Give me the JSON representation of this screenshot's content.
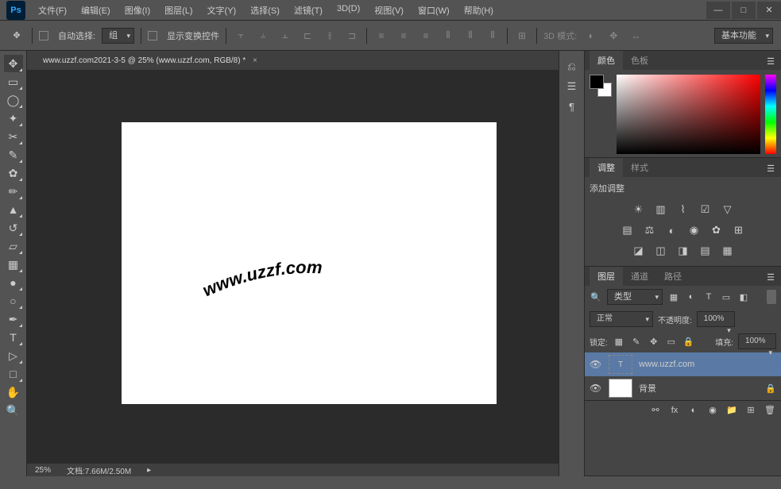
{
  "app": {
    "logo": "Ps"
  },
  "menu": [
    "文件(F)",
    "编辑(E)",
    "图像(I)",
    "图层(L)",
    "文字(Y)",
    "选择(S)",
    "滤镜(T)",
    "3D(D)",
    "视图(V)",
    "窗口(W)",
    "帮助(H)"
  ],
  "optbar": {
    "auto_select": "自动选择:",
    "group": "组",
    "show_transform": "显示变换控件",
    "mode_3d": "3D 模式:",
    "workspace": "基本功能"
  },
  "doc": {
    "tab": "www.uzzf.com2021-3-5 @ 25% (www.uzzf.com, RGB/8) *"
  },
  "canvas": {
    "text": "www.uzzf.com"
  },
  "status": {
    "zoom": "25%",
    "doc": "文档:7.66M/2.50M"
  },
  "panels": {
    "color": {
      "tab1": "颜色",
      "tab2": "色板"
    },
    "adjust": {
      "tab1": "调整",
      "tab2": "样式",
      "title": "添加调整"
    },
    "layers": {
      "tab1": "图层",
      "tab2": "通道",
      "tab3": "路径",
      "kind": "类型",
      "blend": "正常",
      "opacity_label": "不透明度:",
      "opacity": "100%",
      "lock_label": "锁定:",
      "fill_label": "填充:",
      "fill": "100%",
      "items": [
        {
          "name": "www.uzzf.com",
          "type": "text"
        },
        {
          "name": "背景",
          "type": "bg"
        }
      ]
    }
  }
}
